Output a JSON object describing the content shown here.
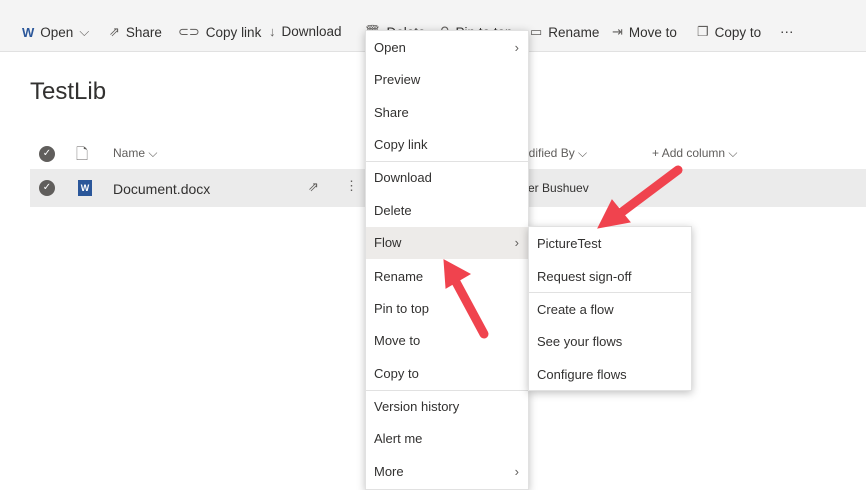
{
  "toolbar": {
    "open": "Open",
    "share": "Share",
    "copy_link": "Copy link",
    "download": "Download",
    "delete": "Delete",
    "pin": "Pin to top",
    "rename": "Rename",
    "move_to": "Move to",
    "copy_to": "Copy to",
    "more": "···"
  },
  "library_title": "TestLib",
  "columns": {
    "name": "Name",
    "modified_by": "Modified By",
    "add_column": "Add column"
  },
  "file": {
    "name": "Document.docx",
    "modified_by": "Peter Bushuev"
  },
  "context_menu": [
    "Open",
    "Preview",
    "Share",
    "Copy link",
    "Download",
    "Delete",
    "Flow",
    "Rename",
    "Pin to top",
    "Move to",
    "Copy to",
    "Version history",
    "Alert me",
    "More"
  ],
  "flow_submenu": [
    "PictureTest",
    "Request sign-off",
    "Create a flow",
    "See your flows",
    "Configure flows"
  ],
  "colors": {
    "arrow": "#f0434e",
    "word": "#2b579a"
  }
}
